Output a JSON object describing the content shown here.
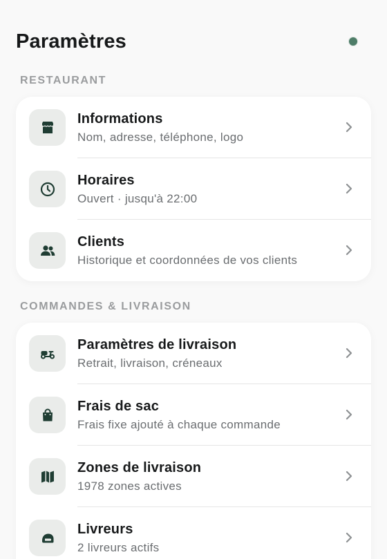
{
  "header": {
    "title": "Paramètres",
    "status_color": "#4e7d68"
  },
  "sections": [
    {
      "label": "RESTAURANT",
      "items": [
        {
          "title": "Informations",
          "subtitle": "Nom, adresse, téléphone, logo",
          "icon": "store-icon"
        },
        {
          "title": "Horaires",
          "subtitle": "Ouvert · jusqu'à 22:00",
          "icon": "clock-icon"
        },
        {
          "title": "Clients",
          "subtitle": "Historique et coordonnées de vos clients",
          "icon": "users-icon"
        }
      ]
    },
    {
      "label": "COMMANDES & LIVRAISON",
      "items": [
        {
          "title": "Paramètres de livraison",
          "subtitle": "Retrait, livraison, créneaux",
          "icon": "scooter-icon"
        },
        {
          "title": "Frais de sac",
          "subtitle": "Frais fixe ajouté à chaque commande",
          "icon": "shopping-bag-icon"
        },
        {
          "title": "Zones de livraison",
          "subtitle": "1978 zones actives",
          "icon": "map-icon"
        },
        {
          "title": "Livreurs",
          "subtitle": "2 livreurs actifs",
          "icon": "helmet-icon"
        }
      ]
    }
  ],
  "colors": {
    "icon": "#1f3d33",
    "icon_bg": "#eaecea",
    "chevron": "#8d9092"
  }
}
